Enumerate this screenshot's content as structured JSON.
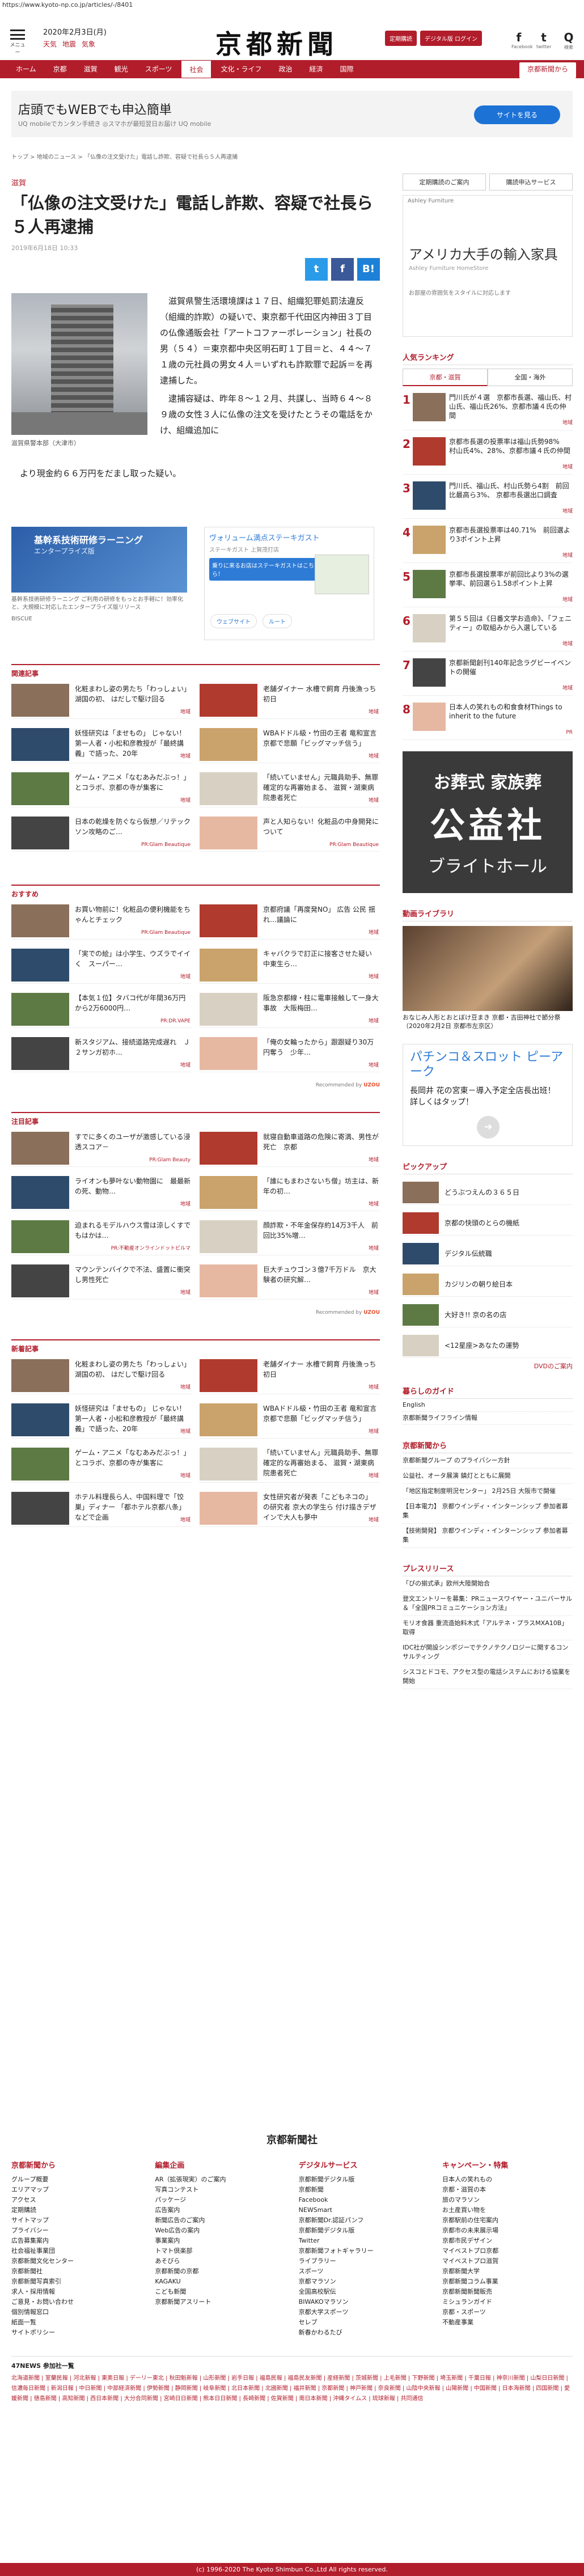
{
  "url": "https://www.kyoto-np.co.jp/articles/-/8401",
  "header": {
    "menu_label": "メニュー",
    "date": "2020年2月3日(月)",
    "weather": [
      "天気",
      "地震",
      "気象"
    ],
    "logo": "京都新聞",
    "btn_trial": "定期購読",
    "btn_digital": "デジタル版 ログイン",
    "social": [
      {
        "glyph": "f",
        "label": "Facebook"
      },
      {
        "glyph": "t",
        "label": "twitter"
      },
      {
        "glyph": "Q",
        "label": "検索"
      }
    ]
  },
  "nav": {
    "items": [
      "ホーム",
      "京都",
      "滋賀",
      "観光",
      "スポーツ",
      "社会",
      "文化・ライフ",
      "政治",
      "経済",
      "国際"
    ],
    "active": "社会",
    "special": "京都新聞から"
  },
  "top_ad": {
    "title": "店頭でもWEBでも申込簡単",
    "sub": "UQ mobileでカンタン手続き ◎スマホが最短翌日お届け UQ mobile",
    "button": "サイトを見る"
  },
  "breadcrumb": "トップ > 地域のニュース > 「仏像の注文受けた」電話し詐欺、容疑で社長ら５人再逮捕",
  "article": {
    "category": "滋賀",
    "title": "「仏像の注文受けた」電話し詐欺、容疑で社長ら５人再逮捕",
    "date": "2019年6月18日 10:33",
    "photo_caption": "滋賀県警本部（大津市）",
    "para1": "滋賀県警生活環境課は１７日、組織犯罪処罰法違反（組織的詐欺）の疑いで、東京都千代田区内神田３丁目の仏像通販会社「アートコファーポレーション」社長の男（５４）＝東京都中央区明石町１丁目＝と、４４～７１歳の元社員の男女４人＝いずれも詐欺罪で起訴＝を再逮捕した。",
    "para2": "逮捕容疑は、昨年８～１２月、共謀し、当時６４～８９歳の女性３人に仏像の注文を受けたとうその電話をかけ、組織追加に",
    "para3": "より現金約６６万円をだまし取った疑い。"
  },
  "share": [
    "t",
    "f",
    "B!"
  ],
  "inline_ads": {
    "left_title": "基幹系技術研修ラーニング",
    "left_sub": "エンタープライズ版",
    "left_caption": "基幹系技術研修ラーニング ご利用の研修をもっとお手軽に！効率化と、大規模に対応したエンタープライズ版リリース",
    "left_brand": "BISCUE",
    "right_title": "ヴォリューム満点ステーキガスト",
    "right_sub": "ステーキガスト 上賀茂打店",
    "right_btn": "乗りに来るお店はステーキガストはこちら！",
    "right_pills": [
      "ウェブサイト",
      "ルート"
    ]
  },
  "related": {
    "title": "関連記事",
    "items": [
      {
        "text": "化粧まわし姿の男たち「わっしょい」 湖国の初、 はだしで駆け回る",
        "tag": "地域"
      },
      {
        "text": "老舗ダイナー 水槽で飼育 丹後漁っち初日",
        "tag": "地域"
      },
      {
        "text": "妖怪研究は「ませもの」 じゃない！ 第一人者・小松和彦教授が「最終講義」で語った、20年",
        "tag": "地域"
      },
      {
        "text": "WBAドドル級・竹田の王者 竜和宣言 京都で悲願「ビッグマッチ信う」",
        "tag": "地域"
      },
      {
        "text": "ゲーム・アニメ「なむあみだぶっ！」とコラボ、京都の寺が集客に",
        "tag": "地域"
      },
      {
        "text": "「続いていません」元職員助手、無罪確定的な再審始まる、 滋賀・湖東病院患者死亡",
        "tag": "地域"
      },
      {
        "text": "日本の乾燥を防ぐなら仮想／リテックソン攻略のご…",
        "tag": "PR:Glam Beautique"
      },
      {
        "text": "声と人知らない！化粧品の中身開発について",
        "tag": "PR:Glam Beautique"
      }
    ]
  },
  "osusume": {
    "title": "おすすめ",
    "items": [
      {
        "text": "お買い物前に！化粧品の便利機能をちゃんとチェック",
        "tag": "PR:Glam Beautique"
      },
      {
        "text": "京都府議「再度発NO」 広告 公民 揺れ…議論に",
        "tag": "地域"
      },
      {
        "text": "「実での絵」は小学生、ウズラでイイく　スーパー…",
        "tag": "地域"
      },
      {
        "text": "キャバクラで訂正に接客させた疑い　中東生ら…",
        "tag": "地域"
      },
      {
        "text": "【本気１位】タバコ代が年間36万円から2万6000円…",
        "tag": "PR:DR.VAPE"
      },
      {
        "text": "阪急京都線・柱に電車接触して一身大事故　大阪梅田…",
        "tag": "地域"
      },
      {
        "text": "新スタジアム、接続道路完成遅れ　Ｊ２サンガ初ホ…",
        "tag": "地域"
      },
      {
        "text": "「俺の女輪ったから」跟跟疑り30万円奪う　少年…",
        "tag": "地域"
      }
    ],
    "recommend": "Recommended by"
  },
  "chumoku": {
    "title": "注目記事",
    "items": [
      {
        "text": "すでに多くのユーザが激感している浸透スコア－",
        "tag": "PR:Glam Beauty"
      },
      {
        "text": "就寝自動車道路の危険に寄満、男性が死亡　京都",
        "tag": "地域"
      },
      {
        "text": "ライオンも夢叶ない動物園に　最最新の死、動物…",
        "tag": "地域"
      },
      {
        "text": "「誰にもまわさないち僧」坊主は、新年の初…",
        "tag": "地域"
      },
      {
        "text": "迫まれるモデルハウス雪は涼しくすでもはかは…",
        "tag": "PR:不動産オンラインドットビルマ"
      },
      {
        "text": "顔詐欺・不年金保存約14万3千人　前回比35%増…",
        "tag": "地域"
      },
      {
        "text": "マウンテンバイクで不法、盛置に衝突し男性死亡",
        "tag": "地域"
      },
      {
        "text": "巨大チュウゴン３億7千万ドル　京大験者の研究解…",
        "tag": "地域"
      }
    ],
    "recommend": "Recommended by"
  },
  "shinchaku": {
    "title": "新着記事",
    "items": [
      {
        "text": "化粧まわし姿の男たち「わっしょい」 湖国の初、 はだしで駆け回る",
        "tag": "地域"
      },
      {
        "text": "老舗ダイナー 水槽で飼育 丹後漁っち初日",
        "tag": "地域"
      },
      {
        "text": "妖怪研究は「ませもの」 じゃない！ 第一人者・小松和彦教授が「最終講義」で語った、20年",
        "tag": "地域"
      },
      {
        "text": "WBAドドル級・竹田の王者 竜和宣言 京都で悲願「ビッグマッチ信う」",
        "tag": "地域"
      },
      {
        "text": "ゲーム・アニメ「なむあみだぶっ！」とコラボ、京都の寺が集客に",
        "tag": "地域"
      },
      {
        "text": "「続いていません」元職員助手、無罪確定的な再審始まる、 滋賀・湖東病院患者死亡",
        "tag": "地域"
      },
      {
        "text": "ホテル料理長ら人、中国料理で「饺巣」ディナー 「都ホテル京都八条」などで企画",
        "tag": "地域"
      },
      {
        "text": "女性研究者が発表「こどもネコの」 の研究者 京大の学生ら 付け描きデザインで大人も夢中",
        "tag": "地域"
      }
    ]
  },
  "sidebar": {
    "link_buttons": [
      "定期購読のご案内",
      "購読申込サービス"
    ],
    "ad_head": "Ashley Furniture",
    "ad_title": "アメリカ大手の輸入家具",
    "ad_sub": "Ashley Furniture HomeStore",
    "ad_body": "お部屋の雰囲気をスタイルに対応します",
    "ranking_title": "人気ランキング",
    "ranking_tabs": [
      "京都・滋賀",
      "全国・海外"
    ],
    "ranking": [
      {
        "n": "1",
        "text": "門川氏が４選　京都市長選、福山氏、村山氏、福山氏26%、京都市議４氏の仲間",
        "tag": "地域"
      },
      {
        "n": "2",
        "text": "京都市長選の投票率は福山氏勢98%　村山氏4%、28%、京都市議４氏の仲間",
        "tag": "地域"
      },
      {
        "n": "3",
        "text": "門川氏、福山氏、村山氏勢ら4割　前回比最高ら3%、 京都市長選出口調査",
        "tag": "地域"
      },
      {
        "n": "4",
        "text": "京都市長選投票率は40.71%　前回選より3ポイント上昇",
        "tag": "地域"
      },
      {
        "n": "5",
        "text": "京都市長選投票率が前回比より3%の選挙率、前回選ら1.58ポイント上昇",
        "tag": "地域"
      },
      {
        "n": "6",
        "text": "第５５回は《日番文学お造命》、「フェニティー」の取組みから入選している",
        "tag": "地域"
      },
      {
        "n": "7",
        "text": "京都新聞創刊140年記念ラグビーイベントの開催",
        "tag": "地域"
      },
      {
        "n": "8",
        "text": "日本人の笑れもの和食食材Things to inherit to the future",
        "tag": "PR"
      }
    ],
    "sogi_1": "お葬式 家族葬",
    "sogi_2": "公益社",
    "sogi_3": "ブライトホール",
    "video_title": "動画ライブラリ",
    "video_caption": "おなじみ人形とおとぼけ豆まき 京都・吉田神社で節分祭（2020年2月2日 京都市左京区）",
    "pachi_title": "パチンコ＆スロット ピーアーク",
    "pachi_sub": "長岡井 花の宮東－導入予定全店長出班！ 詳しくはタップ！",
    "pickup_title": "ピックアップ",
    "pickup": [
      {
        "text": "どうぶつえんの３６５日"
      },
      {
        "text": "京都の快頭のとらの機紙"
      },
      {
        "text": "デジタル伝統職"
      },
      {
        "text": "カジリンの朝り絵日本"
      },
      {
        "text": "大好き!! 京の名の店"
      },
      {
        "text": "<12星座>あなたの運勢"
      }
    ],
    "dvd": "DVDのご案内",
    "kurashi_title": "暮らしのガイド",
    "kurashi": [
      "English",
      "京都新聞ライフライン情報"
    ],
    "from_title": "京都新聞から",
    "from_items": [
      "京都新聞グループ のプライバシー方針",
      "公益社、オータ展演 鎮灯とともに展開",
      "「地区指定制度明況センター」 2月25日 大阪市で開催",
      "【日本電力】 京都ウインディ・インターンシップ 参加者募集",
      "【技術開発】 京都ウインディ・インターンシップ 参加者募集"
    ],
    "press_title": "プレスリリース",
    "press": [
      "「ぴの揃式承」欧州大陸開始合",
      "登文エントリーを募集：PRニュースワイヤー・ユニバーサル＆「全国PRコミュニケーション方法」",
      "モリオ食器 重流造始料木式「アルテネ・プラスMXA10B」取得",
      "IDC社が開設シンポジーでテクノテクノロジーに関するコンサルティング",
      "シスコとドコモ、アクセス型の電話システムにおける協業を開始"
    ]
  },
  "footer": {
    "logo": "京都新聞社",
    "cols": [
      {
        "title": "京都新聞から",
        "items": [
          "グループ概要",
          "エリアマップ",
          "アクセス",
          "定期購読",
          "サイトマップ",
          "プライバシー",
          "広告募集案内",
          "社会福祉事業団",
          "京都新聞文化センター",
          "京都新聞社",
          "京都新聞写真索引",
          "求人・採用情報",
          "ご意見・お問い合わせ",
          "個別情報窓口",
          "紙面一覧",
          "サイトポリシー"
        ]
      },
      {
        "title": "編集企画",
        "items": [
          "AR（拡張現実）のご案内",
          "写真コンテスト",
          "パッケージ",
          "広告案内",
          "新聞広告のご案内",
          "Web広告の案内",
          "事業案内",
          "トマト倶楽部",
          "あそびら",
          "京都新聞の京都",
          "KAGAKU",
          "こども新聞",
          "京都新聞アスリート"
        ]
      },
      {
        "title": "デジタルサービス",
        "items": [
          "京都新聞デジタル版",
          "京都新聞",
          "Facebook",
          "NEWSmart",
          "京都新聞Dr.認証パンフ",
          "京都新聞デジタル版",
          "Twitter",
          "京都新聞フォトギャラリー",
          "ライブラリー",
          "スポーツ",
          "京都マラソン",
          "全国高校駅伝",
          "BIWAKOマラソン",
          "京都大学スポーツ",
          "セレブ",
          "新春かわるたび"
        ]
      },
      {
        "title": "キャンペーン・特集",
        "items": [
          "日本人の笑れもの",
          "京都・滋賀の本",
          "旅のマラソン",
          "お土産買い物を",
          "京都駅前の住宅案内",
          "京都市の未来展示場",
          "京都市民デザイン",
          "マイベストプロ京都",
          "マイベストプロ滋賀",
          "京都新聞大学",
          "京都新聞コラム事業",
          "京都新聞新聞販売",
          "ミシュランガイド",
          "京都・スポーツ",
          "不動産事業"
        ]
      }
    ],
    "news47_title": "47NEWS 参加社一覧",
    "news47_members": "北海道新聞 | 室蘭民報 | 河北新報 | 東奥日報 | デーリー東北 | 秋田魁新報 | 山形新聞 | 岩手日報 | 福島民報 | 福島民友新聞 | 産経新聞 | 茨城新聞 | 上毛新聞 | 下野新聞 | 埼玉新聞 | 千葉日報 | 神奈川新聞 | 山梨日日新聞 | 信濃毎日新聞 | 新潟日報 | 中日新聞 | 中部経済新聞 | 伊勢新聞 | 静岡新聞 | 岐阜新聞 | 北日本新聞 | 北國新聞 | 福井新聞 | 京都新聞 | 神戸新聞 | 奈良新聞 | 山陰中央新報 | 山陽新聞 | 中国新聞 | 日本海新聞 | 四国新聞 | 愛媛新聞 | 徳島新聞 | 高知新聞 | 西日本新聞 | 大分合同新聞 | 宮崎日日新聞 | 熊本日日新聞 | 長崎新聞 | 佐賀新聞 | 南日本新聞 | 沖縄タイムス | 琉球新報 | 共同通信",
    "copyright": "(c) 1996-2020 The Kyoto Shimbun Co.,Ltd All rights reserved."
  },
  "thumbs": [
    "#8a6f5a",
    "#b03a2e",
    "#2e4b6b",
    "#c9a36b",
    "#5d7a45",
    "#d8d1c3",
    "#444",
    "#e6b8a2"
  ]
}
